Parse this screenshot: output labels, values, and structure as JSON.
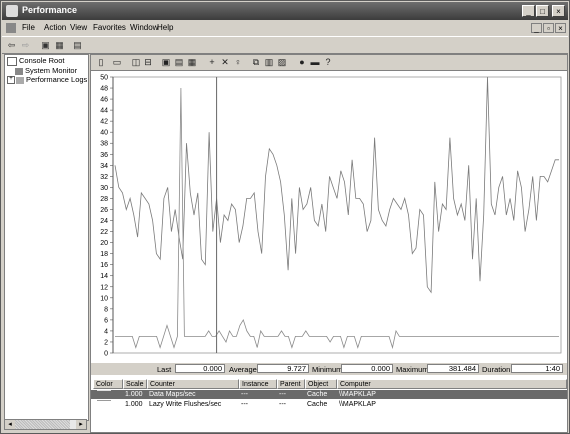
{
  "window": {
    "title": "Performance"
  },
  "menu": {
    "items": [
      "File",
      "Action",
      "View",
      "Favorites",
      "Window",
      "Help"
    ]
  },
  "toolbar_icons": [
    "back-icon",
    "forward-icon",
    "up-icon",
    "show-hide-tree-icon",
    "properties-icon"
  ],
  "tree": {
    "root": "Console Root",
    "items": [
      "System Monitor",
      "Performance Logs a"
    ]
  },
  "monitor_toolbar_icons": [
    "new-counter-set-icon",
    "clear-display-icon",
    "view-current-activity-icon",
    "view-log-data-icon",
    "view-graph-icon",
    "view-histogram-icon",
    "view-report-icon",
    "add-icon",
    "delete-icon",
    "highlight-icon",
    "copy-properties-icon",
    "paste-counter-list-icon",
    "properties-icon",
    "freeze-display-icon",
    "update-data-icon",
    "help-icon"
  ],
  "stats": {
    "last_label": "Last",
    "last_value": "0.000",
    "average_label": "Average",
    "average_value": "9.727",
    "minimum_label": "Minimum",
    "minimum_value": "0.000",
    "maximum_label": "Maximum",
    "maximum_value": "381.484",
    "duration_label": "Duration",
    "duration_value": "1:40"
  },
  "legend": {
    "columns": [
      "Color",
      "Scale",
      "Counter",
      "Instance",
      "Parent",
      "Object",
      "Computer"
    ],
    "rows": [
      {
        "scale": "1.000",
        "counter": "Data Maps/sec",
        "instance": "---",
        "parent": "---",
        "object": "Cache",
        "computer": "\\\\MAPKLAP",
        "color": "#9a9a9a",
        "selected": true
      },
      {
        "scale": "1.000",
        "counter": "Lazy Write Flushes/sec",
        "instance": "---",
        "parent": "---",
        "object": "Cache",
        "computer": "\\\\MAPKLAP",
        "color": "#9a9a9a",
        "selected": false
      }
    ]
  },
  "chart_data": {
    "type": "line",
    "ylim": [
      0,
      50
    ],
    "y_ticks": [
      "0",
      "2",
      "4",
      "6",
      "8",
      "10",
      "12",
      "14",
      "16",
      "18",
      "20",
      "22",
      "24",
      "26",
      "28",
      "30",
      "32",
      "34",
      "36",
      "38",
      "40",
      "42",
      "44",
      "46",
      "48",
      "50"
    ],
    "series": [
      {
        "values": [
          34,
          30,
          29,
          26,
          28,
          25,
          21,
          29,
          28,
          27,
          24,
          18,
          17,
          28,
          30,
          22,
          26,
          21,
          17,
          38,
          29,
          25,
          29,
          17,
          16,
          40,
          22,
          28,
          20,
          25,
          24,
          27,
          26,
          20,
          23,
          28,
          28,
          29,
          22,
          18,
          32,
          37,
          36,
          34,
          31,
          25,
          15,
          28,
          18,
          30,
          26,
          27,
          30,
          24,
          23,
          27,
          22,
          32,
          30,
          28,
          33,
          31,
          25,
          35,
          28,
          28,
          27,
          22,
          24,
          39,
          26,
          24,
          23,
          26,
          28,
          27,
          26,
          28,
          25,
          18,
          19,
          26,
          25,
          12,
          11,
          31,
          22,
          27,
          26,
          39,
          28,
          25,
          27,
          24,
          34,
          17,
          28,
          13,
          25,
          50,
          27,
          25,
          30,
          32,
          25,
          28,
          24,
          33,
          30,
          22,
          26,
          32,
          24,
          32,
          32,
          31,
          33,
          35,
          35
        ]
      },
      {
        "values": [
          3,
          3,
          3,
          3,
          3,
          3,
          1,
          3,
          3,
          3,
          3,
          3,
          3,
          1,
          3,
          5,
          3,
          1,
          3,
          48,
          3,
          3,
          3,
          3,
          3,
          3,
          3,
          4,
          3,
          3,
          4,
          3,
          2,
          4,
          3,
          3,
          5,
          6,
          4,
          3,
          3,
          1,
          4,
          3,
          3,
          3,
          3,
          3,
          4,
          3,
          3,
          1,
          3,
          3,
          3,
          4,
          3,
          3,
          3,
          3,
          3,
          3,
          2,
          3,
          3,
          3,
          1,
          3,
          3,
          3,
          1,
          3,
          3,
          3,
          3,
          3,
          3,
          3,
          3,
          3,
          1,
          4,
          3,
          3,
          3,
          3,
          3,
          3,
          3,
          3,
          3,
          3,
          3,
          3,
          3,
          3,
          3,
          3,
          3,
          3,
          3,
          3,
          3,
          3,
          3,
          3,
          3,
          3,
          3,
          3,
          3,
          3,
          3,
          3,
          3,
          3,
          3,
          3,
          3,
          3,
          3,
          3,
          3,
          3,
          3,
          3,
          3,
          3,
          3
        ]
      }
    ],
    "grid": false
  }
}
